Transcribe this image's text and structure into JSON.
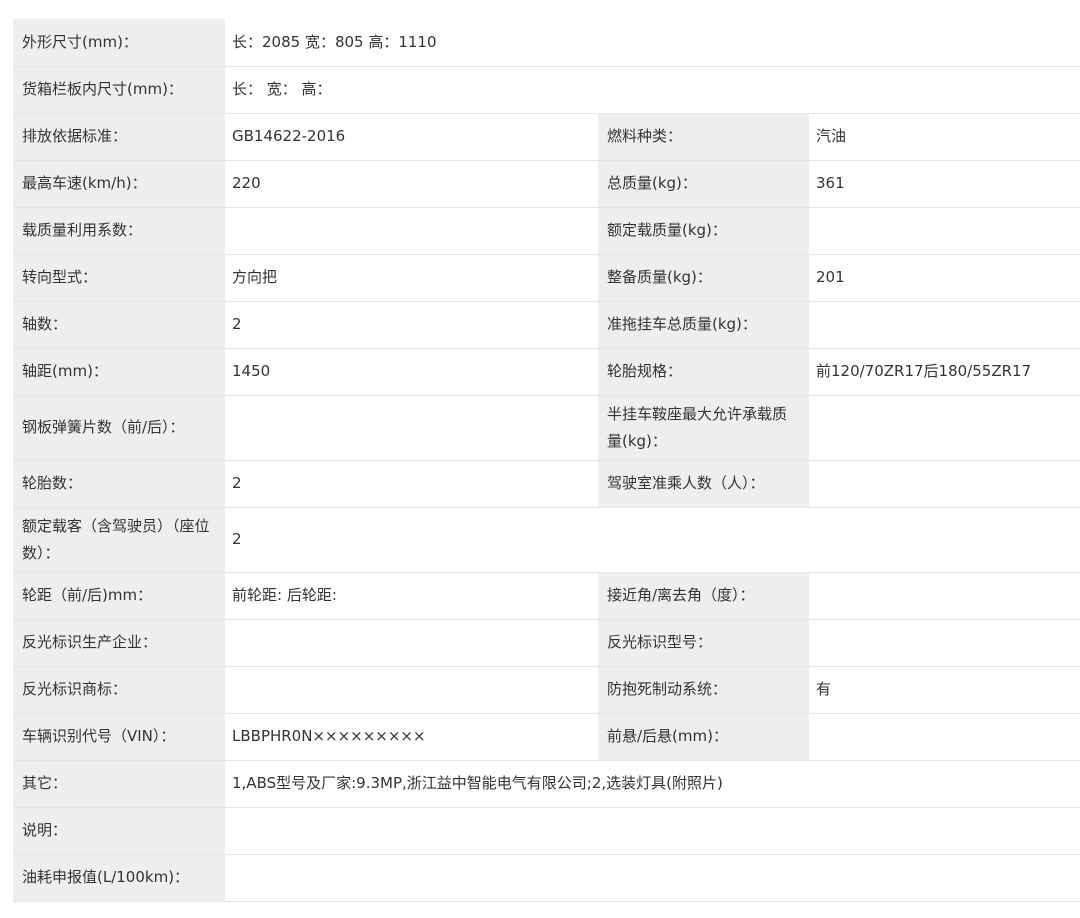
{
  "spec_table": {
    "rows": [
      {
        "cells": [
          {
            "label": "外形尺寸(mm)：",
            "value": "长：2085 宽：805 高：1110"
          }
        ]
      },
      {
        "cells": [
          {
            "label": "货箱栏板内尺寸(mm)：",
            "value": "长： 宽： 高："
          }
        ]
      },
      {
        "cells": [
          {
            "label": "排放依据标准：",
            "value": "GB14622-2016"
          },
          {
            "label": "燃料种类：",
            "value": "汽油"
          }
        ]
      },
      {
        "cells": [
          {
            "label": "最高车速(km/h)：",
            "value": "220"
          },
          {
            "label": "总质量(kg)：",
            "value": "361"
          }
        ]
      },
      {
        "cells": [
          {
            "label": "载质量利用系数：",
            "value": ""
          },
          {
            "label": "额定载质量(kg)：",
            "value": ""
          }
        ]
      },
      {
        "cells": [
          {
            "label": "转向型式：",
            "value": "方向把"
          },
          {
            "label": "整备质量(kg)：",
            "value": "201"
          }
        ]
      },
      {
        "cells": [
          {
            "label": "轴数：",
            "value": "2"
          },
          {
            "label": "准拖挂车总质量(kg)：",
            "value": ""
          }
        ]
      },
      {
        "cells": [
          {
            "label": "轴距(mm)：",
            "value": "1450"
          },
          {
            "label": "轮胎规格：",
            "value": "前120/70ZR17后180/55ZR17"
          }
        ]
      },
      {
        "cells": [
          {
            "label": "钢板弹簧片数（前/后）：",
            "value": ""
          },
          {
            "label": "半挂车鞍座最大允许承载质量(kg)：",
            "value": ""
          }
        ]
      },
      {
        "cells": [
          {
            "label": "轮胎数：",
            "value": "2"
          },
          {
            "label": "驾驶室准乘人数（人）：",
            "value": ""
          }
        ]
      },
      {
        "cells": [
          {
            "label": "额定载客（含驾驶员）（座位数）：",
            "value": "2"
          }
        ]
      },
      {
        "cells": [
          {
            "label": "轮距（前/后)mm：",
            "value": "前轮距: 后轮距:"
          },
          {
            "label": "接近角/离去角（度）：",
            "value": ""
          }
        ]
      },
      {
        "cells": [
          {
            "label": "反光标识生产企业：",
            "value": ""
          },
          {
            "label": "反光标识型号：",
            "value": ""
          }
        ]
      },
      {
        "cells": [
          {
            "label": "反光标识商标：",
            "value": ""
          },
          {
            "label": "防抱死制动系统：",
            "value": "有"
          }
        ]
      },
      {
        "cells": [
          {
            "label": "车辆识别代号（VIN）：",
            "value": "LBBPHR0N×××××××××"
          },
          {
            "label": "前悬/后悬(mm)：",
            "value": ""
          }
        ]
      },
      {
        "cells": [
          {
            "label": "其它：",
            "value": "1,ABS型号及厂家:9.3MP,浙江益中智能电气有限公司;2,选装灯具(附照片)"
          }
        ]
      },
      {
        "cells": [
          {
            "label": "说明：",
            "value": ""
          }
        ]
      },
      {
        "cells": [
          {
            "label": "油耗申报值(L/100km)：",
            "value": ""
          }
        ]
      }
    ]
  }
}
